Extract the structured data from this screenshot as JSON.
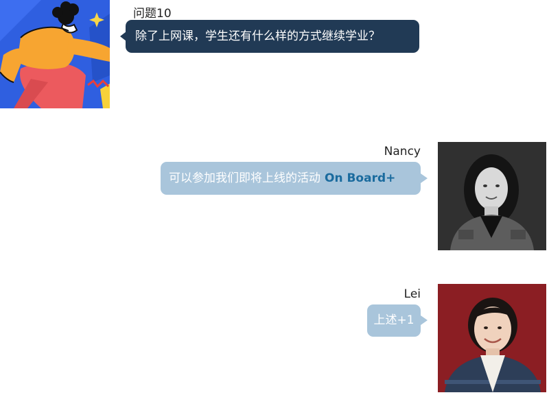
{
  "question": {
    "label": "问题10",
    "text": "除了上网课，学生还有什么样的方式继续学业？"
  },
  "messages": [
    {
      "author": "Nancy",
      "text": "可以参加我们即将上线的活动",
      "highlight": "On Board+"
    },
    {
      "author": "Lei",
      "text": "上述+1",
      "highlight": ""
    }
  ],
  "colors": {
    "question_bubble": "#213a55",
    "reply_bubble": "#a9c5db",
    "accent_text": "#1a6b9e"
  }
}
